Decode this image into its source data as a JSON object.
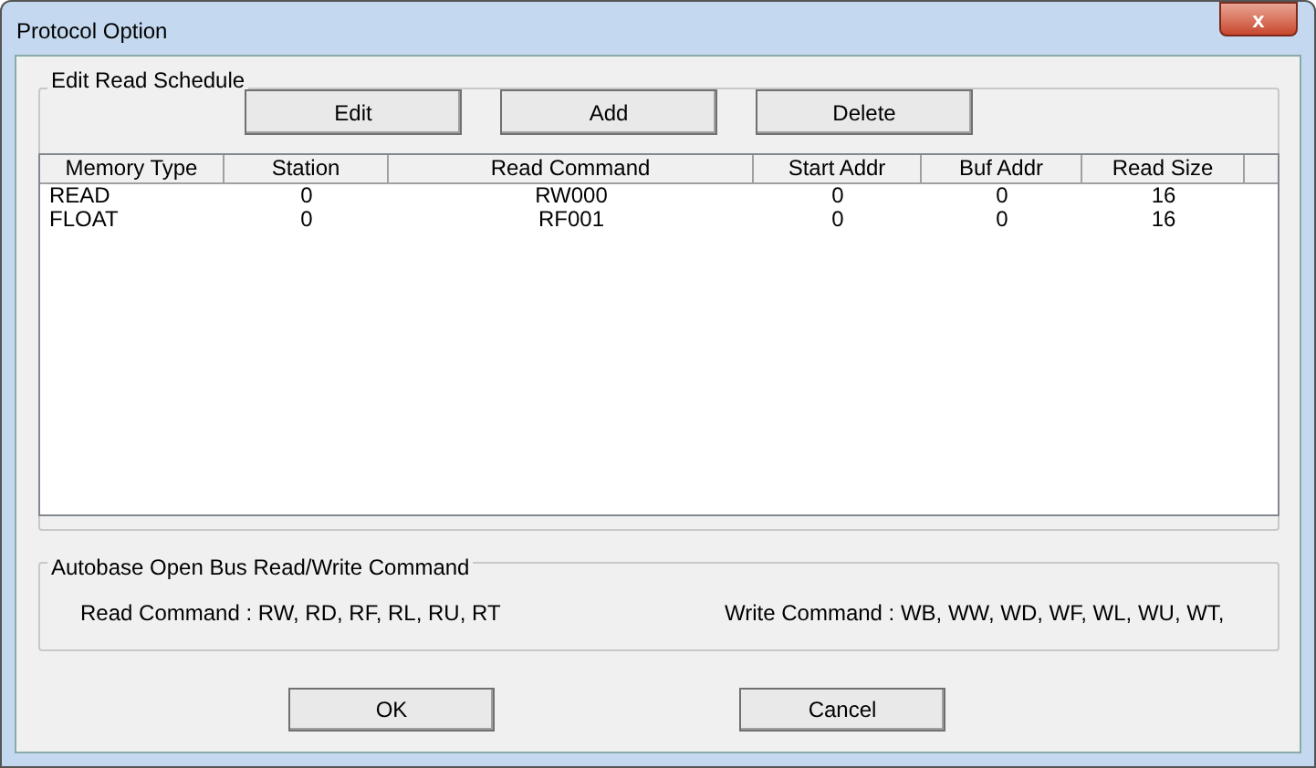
{
  "window": {
    "title": "Protocol Option",
    "close": "x"
  },
  "schedule": {
    "title": "Edit Read Schedule",
    "buttons": [
      "Edit",
      "Add",
      "Delete"
    ],
    "columns": [
      "Memory Type",
      "Station",
      "Read Command",
      "Start Addr",
      "Buf Addr",
      "Read Size"
    ],
    "rows": [
      [
        "READ",
        "0",
        "RW000",
        "0",
        "0",
        "16"
      ],
      [
        "FLOAT",
        "0",
        "RF001",
        "0",
        "0",
        "16"
      ]
    ]
  },
  "commands": {
    "title": "Autobase Open Bus Read/Write Command",
    "read": "Read Command : RW, RD, RF, RL, RU, RT",
    "write": "Write Command : WB, WW, WD, WF, WL, WU, WT,"
  },
  "buttons": [
    "OK",
    "Cancel"
  ]
}
